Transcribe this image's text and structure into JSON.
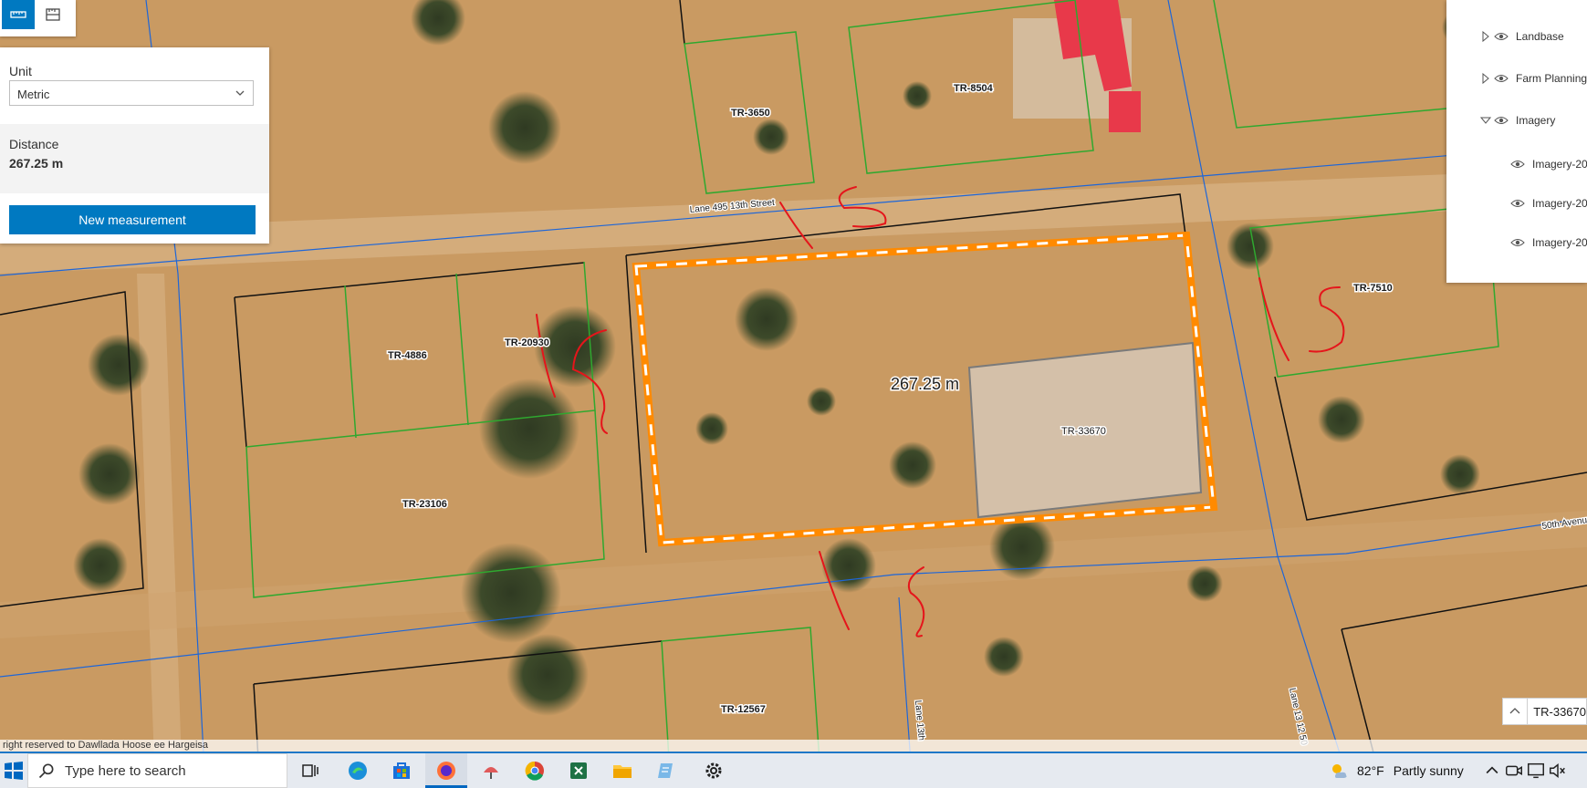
{
  "toolbar": {
    "distance_tool_icon": "ruler-icon",
    "area_tool_icon": "area-measure-icon",
    "accent": "#0079c1"
  },
  "measurement_panel": {
    "unit_label": "Unit",
    "unit_value": "Metric",
    "distance_label": "Distance",
    "distance_value": "267.25 m",
    "new_measurement_label": "New measurement"
  },
  "map": {
    "measure_label": "267.25 m",
    "highlighted_parcel": "TR-33670",
    "parcels": [
      "TR-3650",
      "TR-8504",
      "TR-4886",
      "TR-20930",
      "TR-23106",
      "TR-7510",
      "TR-12567",
      "TR-33670"
    ],
    "streets": [
      "Lane 495 13th Street",
      "50th Avenue",
      "Lane 13th",
      "Lane 13 12 50"
    ],
    "annotations": [
      "15",
      "15",
      "15",
      "15"
    ],
    "colors": {
      "measure_line": "#ff8a00",
      "parcel_green": "#2fa82f",
      "parcel_black": "#111111",
      "road_blue": "#1e66d8",
      "annotation_red": "#e5151b"
    }
  },
  "layer_list": {
    "items": [
      {
        "label": "Landbase",
        "expanded": false
      },
      {
        "label": "Farm Planning",
        "expanded": false
      },
      {
        "label": "Imagery",
        "expanded": true
      },
      {
        "label": "Imagery-20"
      },
      {
        "label": "Imagery-20"
      },
      {
        "label": "Imagery-20"
      }
    ]
  },
  "feature_table": {
    "tab_label": "TR-33670"
  },
  "attribution": {
    "text": "right reserved to Dawllada Hoose ee Hargeisa"
  },
  "taskbar": {
    "search_placeholder": "Type here to search",
    "temperature": "82°F",
    "condition": "Partly sunny",
    "apps": [
      "task-view-icon",
      "edge-icon",
      "store-icon",
      "firefox-icon",
      "app-icon",
      "chrome-icon",
      "excel-icon",
      "file-explorer-icon",
      "notepad-icon",
      "settings-icon"
    ]
  }
}
